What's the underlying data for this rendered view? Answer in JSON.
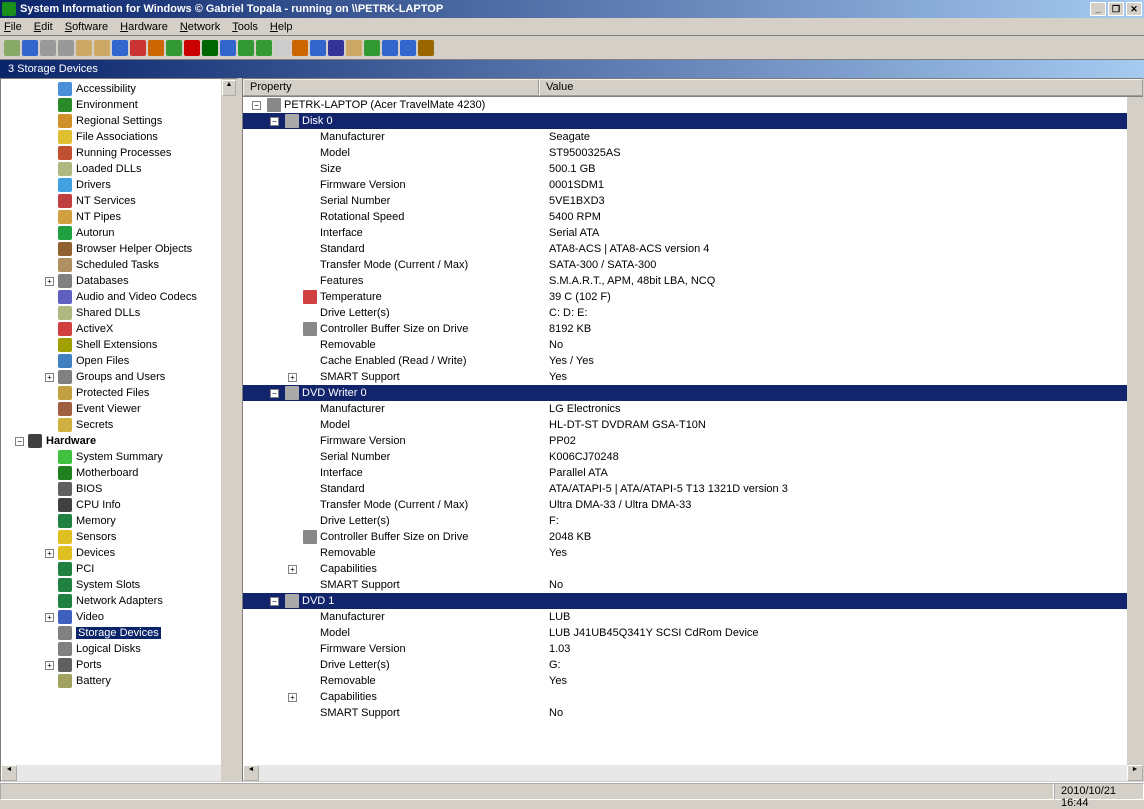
{
  "title": "System Information for Windows   © Gabriel Topala - running on \\\\PETRK-LAPTOP",
  "menu": [
    "File",
    "Edit",
    "Software",
    "Hardware",
    "Network",
    "Tools",
    "Help"
  ],
  "section": "3  Storage Devices",
  "listcols": [
    "Property",
    "Value"
  ],
  "tree": [
    {
      "l": "Accessibility",
      "i": "#4a90d9",
      "d": 1
    },
    {
      "l": "Environment",
      "i": "#2a8a2a",
      "d": 1
    },
    {
      "l": "Regional Settings",
      "i": "#d0902a",
      "d": 1
    },
    {
      "l": "File Associations",
      "i": "#e0c030",
      "d": 1
    },
    {
      "l": "Running Processes",
      "i": "#c05030",
      "d": 1
    },
    {
      "l": "Loaded DLLs",
      "i": "#b0b880",
      "d": 1
    },
    {
      "l": "Drivers",
      "i": "#40a0e0",
      "d": 1
    },
    {
      "l": "NT Services",
      "i": "#c04040",
      "d": 1
    },
    {
      "l": "NT Pipes",
      "i": "#d0a040",
      "d": 1
    },
    {
      "l": "Autorun",
      "i": "#20a040",
      "d": 1
    },
    {
      "l": "Browser Helper Objects",
      "i": "#906030",
      "d": 1
    },
    {
      "l": "Scheduled Tasks",
      "i": "#b09060",
      "d": 1
    },
    {
      "l": "Databases",
      "i": "#808080",
      "d": 1,
      "exp": "+"
    },
    {
      "l": "Audio and Video Codecs",
      "i": "#6060c0",
      "d": 1
    },
    {
      "l": "Shared DLLs",
      "i": "#b0b880",
      "d": 1
    },
    {
      "l": "ActiveX",
      "i": "#d04040",
      "d": 1
    },
    {
      "l": "Shell Extensions",
      "i": "#a0a000",
      "d": 1
    },
    {
      "l": "Open Files",
      "i": "#4080c0",
      "d": 1
    },
    {
      "l": "Groups and Users",
      "i": "#808080",
      "d": 1,
      "exp": "+"
    },
    {
      "l": "Protected Files",
      "i": "#c0a040",
      "d": 1
    },
    {
      "l": "Event Viewer",
      "i": "#a06040",
      "d": 1
    },
    {
      "l": "Secrets",
      "i": "#d0b040",
      "d": 1
    },
    {
      "l": "Hardware",
      "i": "#404040",
      "d": 0,
      "exp": "-",
      "bold": true
    },
    {
      "l": "System Summary",
      "i": "#40c040",
      "d": 1
    },
    {
      "l": "Motherboard",
      "i": "#208020",
      "d": 1
    },
    {
      "l": "BIOS",
      "i": "#606060",
      "d": 1
    },
    {
      "l": "CPU Info",
      "i": "#404040",
      "d": 1
    },
    {
      "l": "Memory",
      "i": "#208040",
      "d": 1
    },
    {
      "l": "Sensors",
      "i": "#e0c020",
      "d": 1
    },
    {
      "l": "Devices",
      "i": "#e0c020",
      "d": 1,
      "exp": "+"
    },
    {
      "l": "PCI",
      "i": "#208040",
      "d": 1
    },
    {
      "l": "System Slots",
      "i": "#208040",
      "d": 1
    },
    {
      "l": "Network Adapters",
      "i": "#208040",
      "d": 1
    },
    {
      "l": "Video",
      "i": "#4060c0",
      "d": 1,
      "exp": "+"
    },
    {
      "l": "Storage Devices",
      "i": "#808080",
      "d": 1,
      "sel": true
    },
    {
      "l": "Logical Disks",
      "i": "#808080",
      "d": 1
    },
    {
      "l": "Ports",
      "i": "#606060",
      "d": 1,
      "exp": "+"
    },
    {
      "l": "Battery",
      "i": "#a0a060",
      "d": 1
    }
  ],
  "rootRow": {
    "exp": "-",
    "icon": "#888",
    "label": "PETRK-LAPTOP (Acer TravelMate 4230)"
  },
  "groups": [
    {
      "name": "Disk 0",
      "rows": [
        [
          "Manufacturer",
          "Seagate"
        ],
        [
          "Model",
          "ST9500325AS"
        ],
        [
          "Size",
          "500.1 GB"
        ],
        [
          "Firmware Version",
          "0001SDM1"
        ],
        [
          "Serial Number",
          "5VE1BXD3"
        ],
        [
          "Rotational Speed",
          "5400 RPM"
        ],
        [
          "Interface",
          "Serial ATA"
        ],
        [
          "Standard",
          "ATA8-ACS | ATA8-ACS version 4"
        ],
        [
          "Transfer Mode (Current / Max)",
          "SATA-300 / SATA-300"
        ],
        [
          "Features",
          "S.M.A.R.T., APM, 48bit LBA, NCQ"
        ],
        [
          "Temperature",
          "39 C (102 F)",
          "#d04040"
        ],
        [
          "Drive Letter(s)",
          "C: D: E:"
        ],
        [
          "Controller Buffer Size on Drive",
          "8192 KB",
          "#888"
        ],
        [
          "Removable",
          "No"
        ],
        [
          "Cache Enabled (Read / Write)",
          "Yes / Yes"
        ],
        [
          "SMART Support",
          "Yes",
          "",
          "+"
        ]
      ]
    },
    {
      "name": "DVD Writer 0",
      "rows": [
        [
          "Manufacturer",
          "LG Electronics"
        ],
        [
          "Model",
          "HL-DT-ST DVDRAM GSA-T10N"
        ],
        [
          "Firmware Version",
          "PP02"
        ],
        [
          "Serial Number",
          "K006CJ70248"
        ],
        [
          "Interface",
          "Parallel ATA"
        ],
        [
          "Standard",
          "ATA/ATAPI-5 | ATA/ATAPI-5 T13 1321D version 3"
        ],
        [
          "Transfer Mode (Current / Max)",
          "Ultra DMA-33 / Ultra DMA-33"
        ],
        [
          "Drive Letter(s)",
          "F:"
        ],
        [
          "Controller Buffer Size on Drive",
          "2048 KB",
          "#888"
        ],
        [
          "Removable",
          "Yes"
        ],
        [
          "Capabilities",
          "",
          "",
          "+"
        ],
        [
          "SMART Support",
          "No"
        ]
      ]
    },
    {
      "name": "DVD 1",
      "rows": [
        [
          "Manufacturer",
          "LUB"
        ],
        [
          "Model",
          "LUB J41UB45Q341Y SCSI CdRom Device"
        ],
        [
          "Firmware Version",
          "1.03"
        ],
        [
          "Drive Letter(s)",
          "G:"
        ],
        [
          "Removable",
          "Yes"
        ],
        [
          "Capabilities",
          "",
          "",
          "+"
        ],
        [
          "SMART Support",
          "No"
        ]
      ]
    }
  ],
  "toolbarColors": [
    "#8a6",
    "#36c",
    "#999",
    "#999",
    "#ca6",
    "#ca6",
    "#36c",
    "#c33",
    "#c60",
    "#393",
    "#c00",
    "#060",
    "#36c",
    "#393",
    "#393",
    "#ccc",
    "#c60",
    "#36c",
    "#339",
    "#ca6",
    "#393",
    "#36c",
    "#36c",
    "#960"
  ],
  "status": {
    "time": "2010/10/21 16:44"
  }
}
